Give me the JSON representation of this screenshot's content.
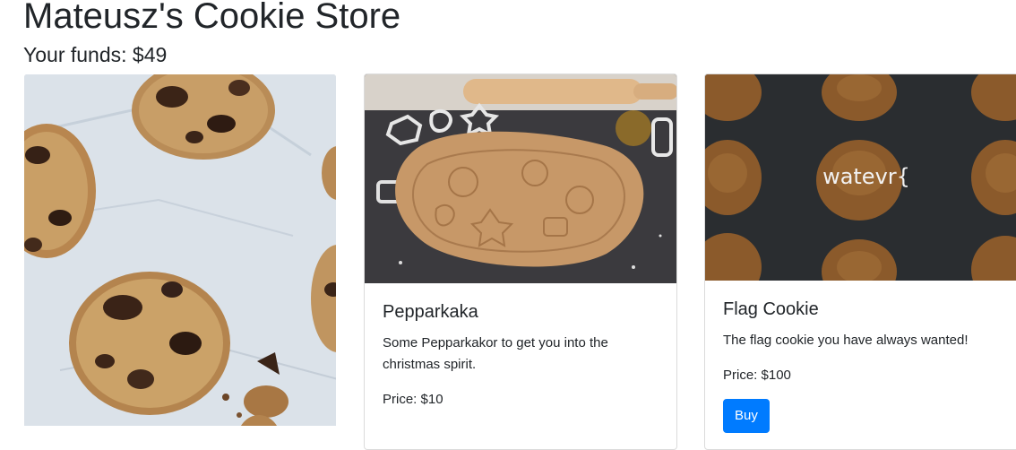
{
  "store": {
    "title": "Mateusz's Cookie Store",
    "funds": "Your funds: $49"
  },
  "products": [
    {
      "image": "chocolate-chip-cookies-photo"
    },
    {
      "image": "gingerbread-dough-with-cutters-photo",
      "title": "Pepparkaka",
      "description": "Some Pepparkakor to get you into the christmas spirit.",
      "price": "Price: $10"
    },
    {
      "image": "ginger-cookies-on-dark-background-photo",
      "image_text": "watevr{",
      "title": "Flag Cookie",
      "description": "The flag cookie you have always wanted!",
      "price": "Price: $100",
      "buy_label": "Buy"
    }
  ],
  "colors": {
    "primary": "#007bff",
    "text": "#212529",
    "card_border": "#dee2e6"
  }
}
